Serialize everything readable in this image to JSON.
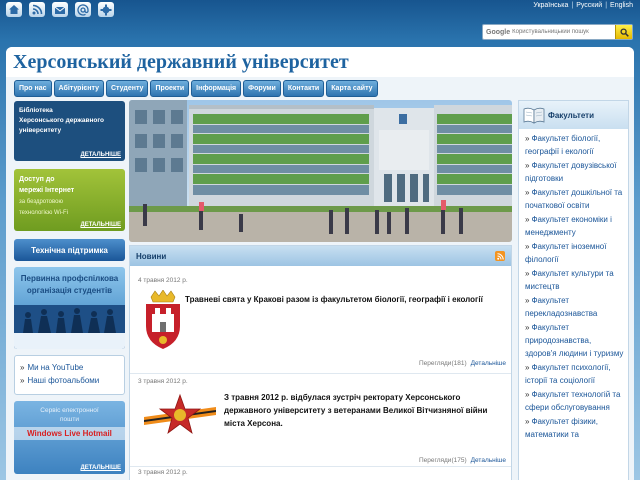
{
  "top_icons": [
    "home-icon",
    "rss-icon",
    "email-icon",
    "at-icon",
    "settings-icon"
  ],
  "lang": {
    "ua": "Українська",
    "ru": "Русский",
    "en": "English",
    "sep": "|"
  },
  "search": {
    "brand": "Google",
    "placeholder": "Користувальницький пошук"
  },
  "site_title": "Херсонський державний університет",
  "nav": [
    "Про нас",
    "Абітурієнту",
    "Студенту",
    "Проекти",
    "Інформація",
    "Форуми",
    "Контакти",
    "Карта сайту"
  ],
  "left": {
    "library": {
      "lines": [
        "Бібліотека",
        "Херсонського державного",
        "університету"
      ],
      "more": "ДЕТАЛЬНІШЕ"
    },
    "internet": {
      "lines": [
        "Доступ до",
        "мережі Інтернет"
      ],
      "sub": [
        "за бездротовою",
        "технологією Wi-Fi"
      ],
      "more": "ДЕТАЛЬНІШЕ"
    },
    "support": "Технічна підтримка",
    "union": {
      "lines": [
        "Первинна профспілкова",
        "організація студентів"
      ]
    },
    "links": [
      "Ми на YouTube",
      "Наші фотоальбоми"
    ],
    "hotmail": {
      "lines": [
        "Сервіс електронної",
        "пошти"
      ],
      "brand": "Windows Live Hotmail",
      "more": "ДЕТАЛЬНІШЕ"
    }
  },
  "news": {
    "heading": "Новини",
    "items": [
      {
        "date": "4 травня 2012 р.",
        "title": "Травневі свята у Кракові разом із факультетом біології, географії і екології",
        "views_label": "Перегляди",
        "views": "(181)",
        "more": "Детальніше"
      },
      {
        "date": "3 травня 2012 р.",
        "title": "З травня 2012 р. відбулася зустріч ректорату Херсонського державного університету з ветеранами Великої Вітчизняної війни міста Херсона.",
        "views_label": "Перегляди",
        "views": "(175)",
        "more": "Детальніше"
      },
      {
        "date": "3 травня 2012 р."
      }
    ]
  },
  "faculties": {
    "heading": "Факультети",
    "items": [
      "Факультет біології, географії і екології",
      "Факультет довузівської підготовки",
      "Факультет дошкільної та початкової освіти",
      "Факультет економіки і менеджменту",
      "Факультет іноземної філології",
      "Факультет культури та мистецтв",
      "Факультет перекладознавства",
      "Факультет природознавства, здоров'я людини і туризму",
      "Факультет психології, історії та соціології",
      "Факультет технологій та сфери обслуговування",
      "Факультет фізики, математики та"
    ]
  }
}
